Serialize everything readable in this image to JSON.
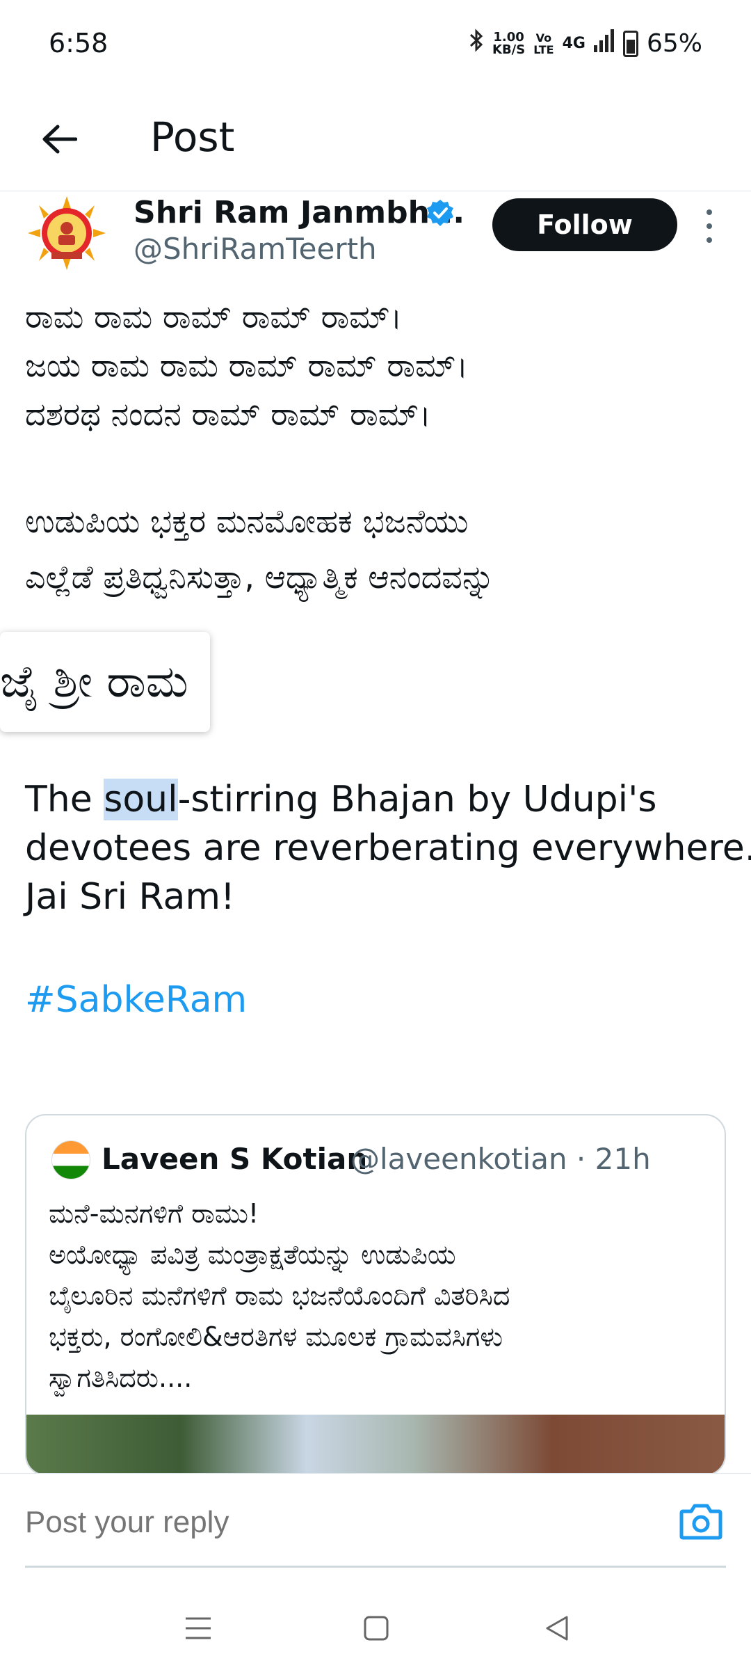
{
  "status_bar": {
    "time": "6:58",
    "net_speed_value": "1.00",
    "net_speed_unit": "KB/S",
    "volte_top": "Vo",
    "volte_bottom": "LTE",
    "signal": "4G",
    "battery": "65%"
  },
  "header": {
    "title": "Post"
  },
  "post": {
    "author_name": "Shri Ram Janmbh...",
    "author_handle": "@ShriRamTeerth",
    "follow_label": "Follow",
    "kannada_lines_1": [
      "ರಾಮ ರಾಮ ರಾಮ್ ರಾಮ್ ರಾಮ್।",
      "ಜಯ ರಾಮ ರಾಮ ರಾಮ್ ರಾಮ್ ರಾಮ್।",
      "ದಶರಥ ನಂದನ ರಾಮ್ ರಾಮ್ ರಾಮ್।"
    ],
    "kannada_lines_2": [
      "ಉಡುಪಿಯ ಭಕ್ತರ ಮನಮೋಹಕ ಭಜನೆಯು",
      "ಎಲ್ಲೆಡೆ ಪ್ರತಿಧ್ವನಿಸುತ್ತಾ, ಆಧ್ಯಾತ್ಮಿಕ ಆನಂದವನ್ನು"
    ],
    "kannada_line_3": "ಜೈ ಶ್ರೀ ರಾಮ್!",
    "english_pre": "The ",
    "english_highlight": "soul",
    "english_post": "-stirring Bhajan by Udupi's",
    "english_line_2": "devotees are reverberating everywhere.",
    "english_line_3": "Jai Sri Ram!",
    "hashtag": "#SabkeRam"
  },
  "popup": {
    "text": "ಜೈ ಶ್ರೀ ರಾಮ"
  },
  "quoted_post": {
    "author_name": "Laveen S Kotian",
    "handle_and_time": "@laveenkotian · 21h",
    "lines": [
      "ಮನೆ-ಮನಗಳಿಗೆ ರಾಮು!",
      "ಅಯೋಧ್ಯಾ ಪವಿತ್ರ ಮಂತ್ರಾಕ್ಷತೆಯನ್ನು ಉಡುಪಿಯ",
      "ಬೈಲೂರಿನ ಮನೆಗಳಿಗೆ ರಾಮ ಭಜನೆಯೊಂದಿಗೆ ವಿತರಿಸಿದ",
      "ಭಕ್ತರು, ರಂಗೋಲಿ&ಆರತಿಗಳ ಮೂಲಕ ಗ್ರಾಮವಸಿಗಳು",
      "ಸ್ವಾಗತಿಸಿದರು...."
    ]
  },
  "reply": {
    "placeholder": "Post your reply"
  },
  "colors": {
    "accent": "#1d9bf0",
    "text_primary": "#0f1419",
    "text_secondary": "#536471",
    "highlight": "#c7ddf5"
  },
  "icons": {
    "back": "arrow-left-icon",
    "verified": "verified-badge-icon",
    "more": "more-vertical-icon",
    "camera": "camera-icon",
    "nav_menu": "menu-icon",
    "nav_home": "square-icon",
    "nav_back": "triangle-back-icon"
  }
}
